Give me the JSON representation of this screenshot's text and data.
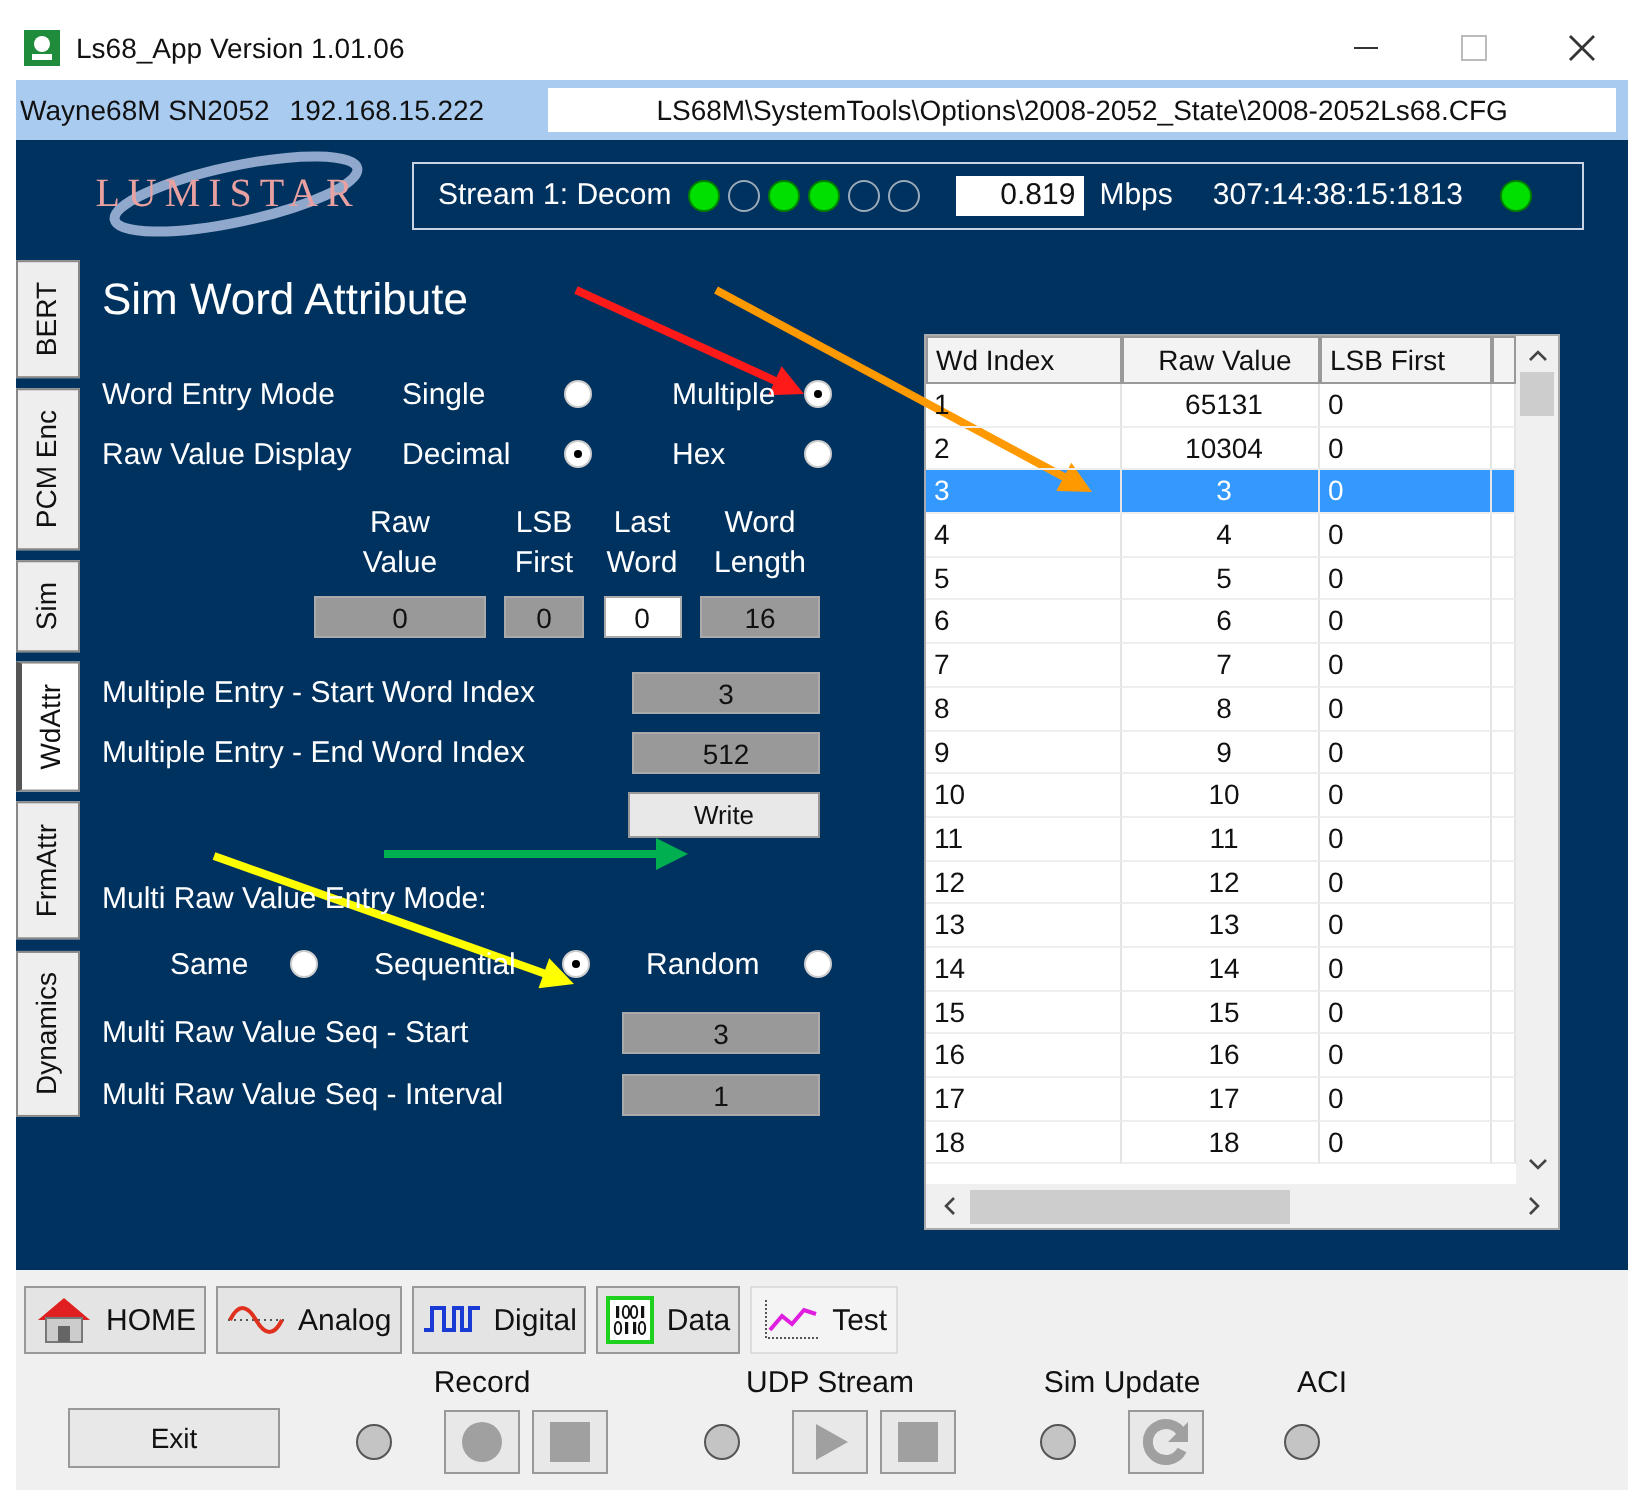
{
  "window": {
    "title": "Ls68_App Version 1.01.06"
  },
  "connection": {
    "device": "Wayne68M SN2052",
    "ip": "192.168.15.222",
    "config_path": "LS68M\\SystemTools\\Options\\2008-2052_State\\2008-2052Ls68.CFG"
  },
  "header": {
    "logo": "LUMISTAR",
    "stream_label": "Stream 1: Decom",
    "stream_leds": [
      {
        "on": true
      },
      {
        "on": false
      },
      {
        "on": true
      },
      {
        "on": true
      },
      {
        "on": false
      },
      {
        "on": false
      }
    ],
    "rate": "0.819",
    "rate_unit": "Mbps",
    "time": "307:14:38:15:1813",
    "status_led": {
      "on": true
    }
  },
  "side_tabs": [
    {
      "label": "BERT",
      "selected": false
    },
    {
      "label": "PCM Enc",
      "selected": false
    },
    {
      "label": "Sim",
      "selected": false
    },
    {
      "label": "WdAttr",
      "selected": true
    },
    {
      "label": "FrmAttr",
      "selected": false
    },
    {
      "label": "Dynamics",
      "selected": false
    }
  ],
  "panel": {
    "title": "Sim Word Attribute",
    "radio_rows": [
      {
        "label": "Word Entry Mode",
        "options": [
          {
            "label": "Single",
            "selected": false
          },
          {
            "label": "Multiple",
            "selected": true
          }
        ]
      },
      {
        "label": "Raw Value Display",
        "options": [
          {
            "label": "Decimal",
            "selected": true
          },
          {
            "label": "Hex",
            "selected": false
          }
        ]
      }
    ],
    "attr_fields": [
      {
        "label": "Raw Value",
        "value": "0",
        "editable": false
      },
      {
        "label": "LSB First",
        "value": "0",
        "editable": false
      },
      {
        "label": "Last Word",
        "value": "0",
        "editable": true
      },
      {
        "label": "Word Length",
        "value": "16",
        "editable": false
      }
    ],
    "index_fields": [
      {
        "label": "Multiple Entry - Start Word Index",
        "value": "3"
      },
      {
        "label": "Multiple Entry - End Word Index",
        "value": "512"
      }
    ],
    "write_button": "Write",
    "multi_mode": {
      "label": "Multi Raw Value Entry Mode:",
      "options": [
        {
          "label": "Same",
          "selected": false
        },
        {
          "label": "Sequential",
          "selected": true
        },
        {
          "label": "Random",
          "selected": false
        }
      ]
    },
    "seq_fields": [
      {
        "label": "Multi Raw Value Seq - Start",
        "value": "3"
      },
      {
        "label": "Multi Raw Value Seq - Interval",
        "value": "1"
      }
    ]
  },
  "table": {
    "columns": [
      "Wd Index",
      "Raw Value",
      "LSB First"
    ],
    "rows": [
      {
        "cells": [
          "1",
          "65131",
          "0"
        ],
        "selected": false
      },
      {
        "cells": [
          "2",
          "10304",
          "0"
        ],
        "selected": false
      },
      {
        "cells": [
          "3",
          "3",
          "0"
        ],
        "selected": true
      },
      {
        "cells": [
          "4",
          "4",
          "0"
        ],
        "selected": false
      },
      {
        "cells": [
          "5",
          "5",
          "0"
        ],
        "selected": false
      },
      {
        "cells": [
          "6",
          "6",
          "0"
        ],
        "selected": false
      },
      {
        "cells": [
          "7",
          "7",
          "0"
        ],
        "selected": false
      },
      {
        "cells": [
          "8",
          "8",
          "0"
        ],
        "selected": false
      },
      {
        "cells": [
          "9",
          "9",
          "0"
        ],
        "selected": false
      },
      {
        "cells": [
          "10",
          "10",
          "0"
        ],
        "selected": false
      },
      {
        "cells": [
          "11",
          "11",
          "0"
        ],
        "selected": false
      },
      {
        "cells": [
          "12",
          "12",
          "0"
        ],
        "selected": false
      },
      {
        "cells": [
          "13",
          "13",
          "0"
        ],
        "selected": false
      },
      {
        "cells": [
          "14",
          "14",
          "0"
        ],
        "selected": false
      },
      {
        "cells": [
          "15",
          "15",
          "0"
        ],
        "selected": false
      },
      {
        "cells": [
          "16",
          "16",
          "0"
        ],
        "selected": false
      },
      {
        "cells": [
          "17",
          "17",
          "0"
        ],
        "selected": false
      },
      {
        "cells": [
          "18",
          "18",
          "0"
        ],
        "selected": false
      }
    ]
  },
  "bottom_tabs": [
    {
      "label": "HOME",
      "kind": "home",
      "selected": false
    },
    {
      "label": "Analog",
      "kind": "analog",
      "selected": false
    },
    {
      "label": "Digital",
      "kind": "digital",
      "selected": false
    },
    {
      "label": "Data",
      "kind": "data",
      "selected": false
    },
    {
      "label": "Test",
      "kind": "test",
      "selected": true
    }
  ],
  "controls": {
    "exit": "Exit",
    "groups": [
      {
        "label": "Record",
        "led_on": false,
        "buttons": [
          {
            "kind": "record"
          },
          {
            "kind": "stop"
          }
        ]
      },
      {
        "label": "UDP Stream",
        "led_on": false,
        "buttons": [
          {
            "kind": "play"
          },
          {
            "kind": "stop"
          }
        ]
      },
      {
        "label": "Sim Update",
        "led_on": false,
        "buttons": [
          {
            "kind": "refresh"
          }
        ]
      },
      {
        "label": "ACI",
        "led_on": false
      }
    ]
  },
  "annotations": [
    {
      "color": "#ff1a1a"
    },
    {
      "color": "#ff9900"
    },
    {
      "color": "#ffff00"
    },
    {
      "color": "#00b050"
    }
  ]
}
